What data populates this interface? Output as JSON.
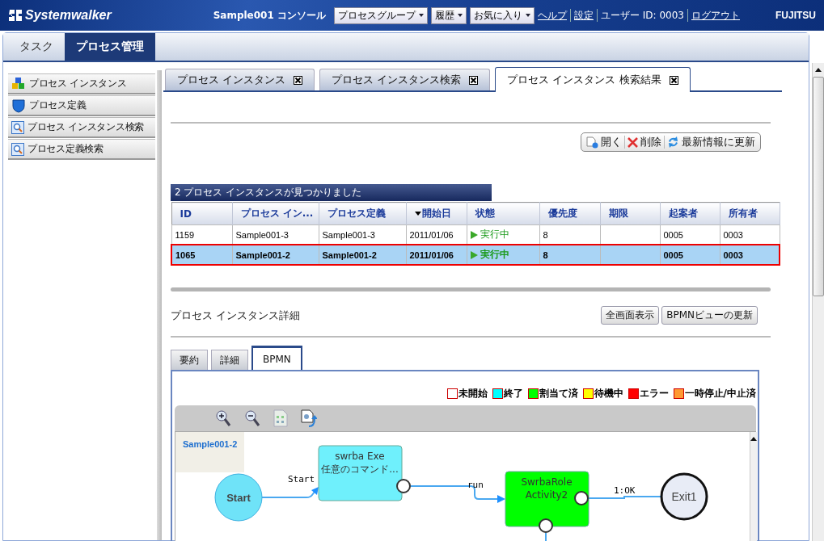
{
  "header": {
    "logo": "Systemwalker",
    "console_title": "Sample001 コンソール",
    "menus": [
      {
        "label": "プロセスグループ"
      },
      {
        "label": "履歴"
      },
      {
        "label": "お気に入り"
      }
    ],
    "links": [
      {
        "label": "ヘルプ"
      },
      {
        "label": "設定"
      }
    ],
    "user": "ユーザー ID: 0003",
    "logout": "ログアウト",
    "brand": "FUJITSU"
  },
  "main_tabs": [
    {
      "label": "タスク",
      "selected": false
    },
    {
      "label": "プロセス管理",
      "selected": true
    }
  ],
  "sidebar": {
    "items": [
      {
        "label": "プロセス インスタンス",
        "kind": "cubes"
      },
      {
        "label": "プロセス定義",
        "kind": "shield"
      },
      {
        "label": "プロセス インスタンス検索",
        "kind": "search"
      },
      {
        "label": "プロセス定義検索",
        "kind": "search"
      }
    ]
  },
  "content_tabs": [
    {
      "label": "プロセス インスタンス",
      "selected": false
    },
    {
      "label": "プロセス インスタンス検索",
      "selected": false
    },
    {
      "label": "プロセス インスタンス 検索結果",
      "selected": true
    }
  ],
  "toolbar": [
    {
      "label": "開く",
      "kind": "open"
    },
    {
      "label": "削除",
      "kind": "delete"
    },
    {
      "label": "最新情報に更新",
      "kind": "refresh"
    }
  ],
  "results": {
    "caption": "2 プロセス インスタンスが見つかりました",
    "columns": [
      {
        "label": "ID",
        "sorted": false
      },
      {
        "label": "プロセス イン...",
        "sorted": false
      },
      {
        "label": "プロセス定義",
        "sorted": false
      },
      {
        "label": "開始日",
        "sorted": true
      },
      {
        "label": "状態",
        "sorted": false,
        "kind": "status"
      },
      {
        "label": "優先度",
        "sorted": false
      },
      {
        "label": "期限",
        "sorted": false
      },
      {
        "label": "起案者",
        "sorted": false
      },
      {
        "label": "所有者",
        "sorted": false
      }
    ],
    "rows": [
      {
        "selected": false,
        "cells": [
          "1159",
          "Sample001-3",
          "Sample001-3",
          "2011/01/06",
          "実行中",
          "8",
          "",
          "0005",
          "0003"
        ]
      },
      {
        "selected": true,
        "cells": [
          "1065",
          "Sample001-2",
          "Sample001-2",
          "2011/01/06",
          "実行中",
          "8",
          "",
          "0005",
          "0003"
        ]
      }
    ]
  },
  "detail": {
    "title": "プロセス インスタンス詳細",
    "buttons": [
      {
        "label": "全画面表示"
      },
      {
        "label": "BPMNビューの更新"
      }
    ],
    "tabs": [
      {
        "label": "要約",
        "selected": false
      },
      {
        "label": "詳細",
        "selected": false
      },
      {
        "label": "BPMN",
        "selected": true
      }
    ],
    "legend": [
      {
        "label": "未開始",
        "color": "#ffffff"
      },
      {
        "label": "終了",
        "color": "#00ffff"
      },
      {
        "label": "割当て済",
        "color": "#00ff00"
      },
      {
        "label": "待機中",
        "color": "#ffff00"
      },
      {
        "label": "エラー",
        "color": "#ff0000"
      },
      {
        "label": "一時停止/中止済",
        "color": "#ff9933"
      }
    ],
    "diagram": {
      "title": "Sample001-2",
      "nodes": [
        {
          "kind": "start",
          "lines": [
            "Start"
          ]
        },
        {
          "kind": "task",
          "color": "#6ff0fc",
          "lines": [
            "swrba Exe",
            "任意のコマンド..."
          ]
        },
        {
          "kind": "task",
          "color": "#00ff00",
          "lines": [
            "SwrbaRole",
            "Activity2"
          ]
        },
        {
          "kind": "end",
          "lines": [
            "Exit1"
          ]
        }
      ],
      "edges": [
        {
          "label": "Start"
        },
        {
          "label": "run"
        },
        {
          "label": "1:OK"
        }
      ]
    }
  }
}
